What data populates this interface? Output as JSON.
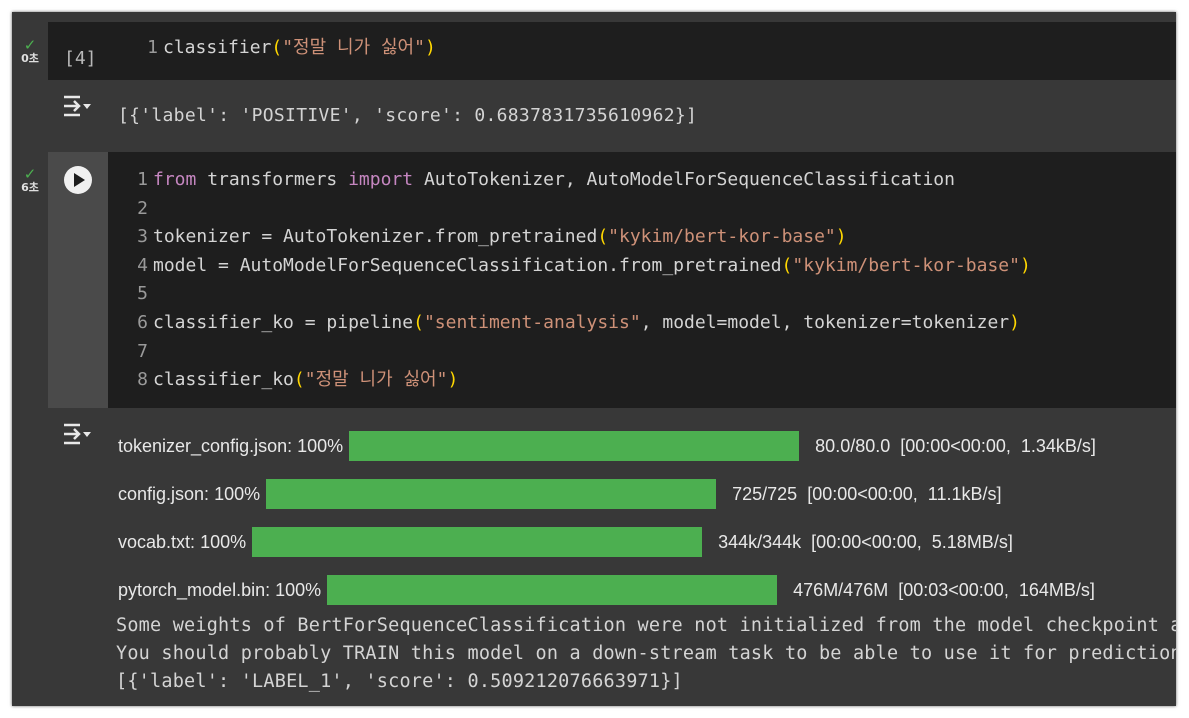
{
  "cells": [
    {
      "status_time": "0초",
      "exec_count": "[4]",
      "code_line_no": "1",
      "code_fn": "classifier",
      "code_arg": "\"정말 니가 싫어\"",
      "output": "[{'label': 'POSITIVE', 'score': 0.6837831735610962}]"
    },
    {
      "status_time": "6초",
      "lines": [
        {
          "no": "1"
        },
        {
          "no": "2"
        },
        {
          "no": "3"
        },
        {
          "no": "4"
        },
        {
          "no": "5"
        },
        {
          "no": "6"
        },
        {
          "no": "7"
        },
        {
          "no": "8"
        }
      ],
      "l1": {
        "kw1": "from",
        "mod": " transformers ",
        "kw2": "import",
        "rest": " AutoTokenizer, AutoModelForSequenceClassification"
      },
      "l3": {
        "lhs": "tokenizer = AutoTokenizer.from_pretrained",
        "arg": "\"kykim/bert-kor-base\""
      },
      "l4": {
        "lhs": "model = AutoModelForSequenceClassification.from_pretrained",
        "arg": "\"kykim/bert-kor-base\""
      },
      "l6": {
        "lhs": "classifier_ko = pipeline",
        "arg": "\"sentiment-analysis\"",
        "rest": ", model=model, tokenizer=tokenizer"
      },
      "l8": {
        "lhs": "classifier_ko",
        "arg": "\"정말 니가 싫어\""
      },
      "progress": [
        {
          "name": "tokenizer_config.json:",
          "pct": "100%",
          "stats": "80.0/80.0  [00:00<00:00,  1.34kB/s]"
        },
        {
          "name": "config.json:",
          "pct": "100%",
          "stats": "725/725  [00:00<00:00,  11.1kB/s]"
        },
        {
          "name": "vocab.txt:",
          "pct": "100%",
          "stats": "344k/344k  [00:00<00:00,  5.18MB/s]"
        },
        {
          "name": "pytorch_model.bin:",
          "pct": "100%",
          "stats": "476M/476M  [00:03<00:00,  164MB/s]"
        }
      ],
      "log": [
        "Some weights of BertForSequenceClassification were not initialized from the model checkpoint at k",
        "You should probably TRAIN this model on a down-stream task to be able to use it for predictions a",
        "[{'label': 'LABEL_1', 'score': 0.509212076663971}]"
      ]
    }
  ],
  "colors": {
    "success": "#4caf50",
    "keyword": "#c586c0",
    "string": "#ce9178",
    "paren": "#ffd700"
  }
}
